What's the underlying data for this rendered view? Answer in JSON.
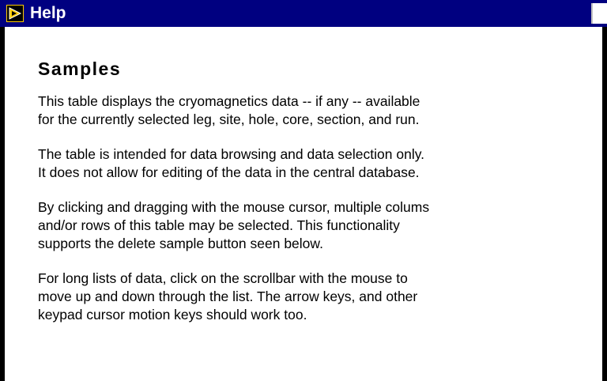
{
  "window": {
    "title": "Help",
    "colors": {
      "titlebar": "#000080",
      "title_text": "#ffffff",
      "background": "#ffffff"
    }
  },
  "help": {
    "heading": "Samples",
    "paragraphs": [
      "This table displays the cryomagnetics data -- if any -- available\nfor the currently selected leg, site, hole, core, section, and run.",
      "The table is intended for data browsing and data selection only.\nIt does not allow for editing of the data in the central database.",
      "By clicking and dragging with the mouse cursor, multiple colums\nand/or rows of this table may be selected. This functionality\nsupports the delete sample button seen below.",
      "For long lists of data, click on the scrollbar with the mouse to\nmove up and down through the list. The arrow keys, and other\nkeypad cursor motion keys should work too."
    ]
  },
  "icons": {
    "app": "labview-run-icon",
    "title_button": "window-button"
  }
}
